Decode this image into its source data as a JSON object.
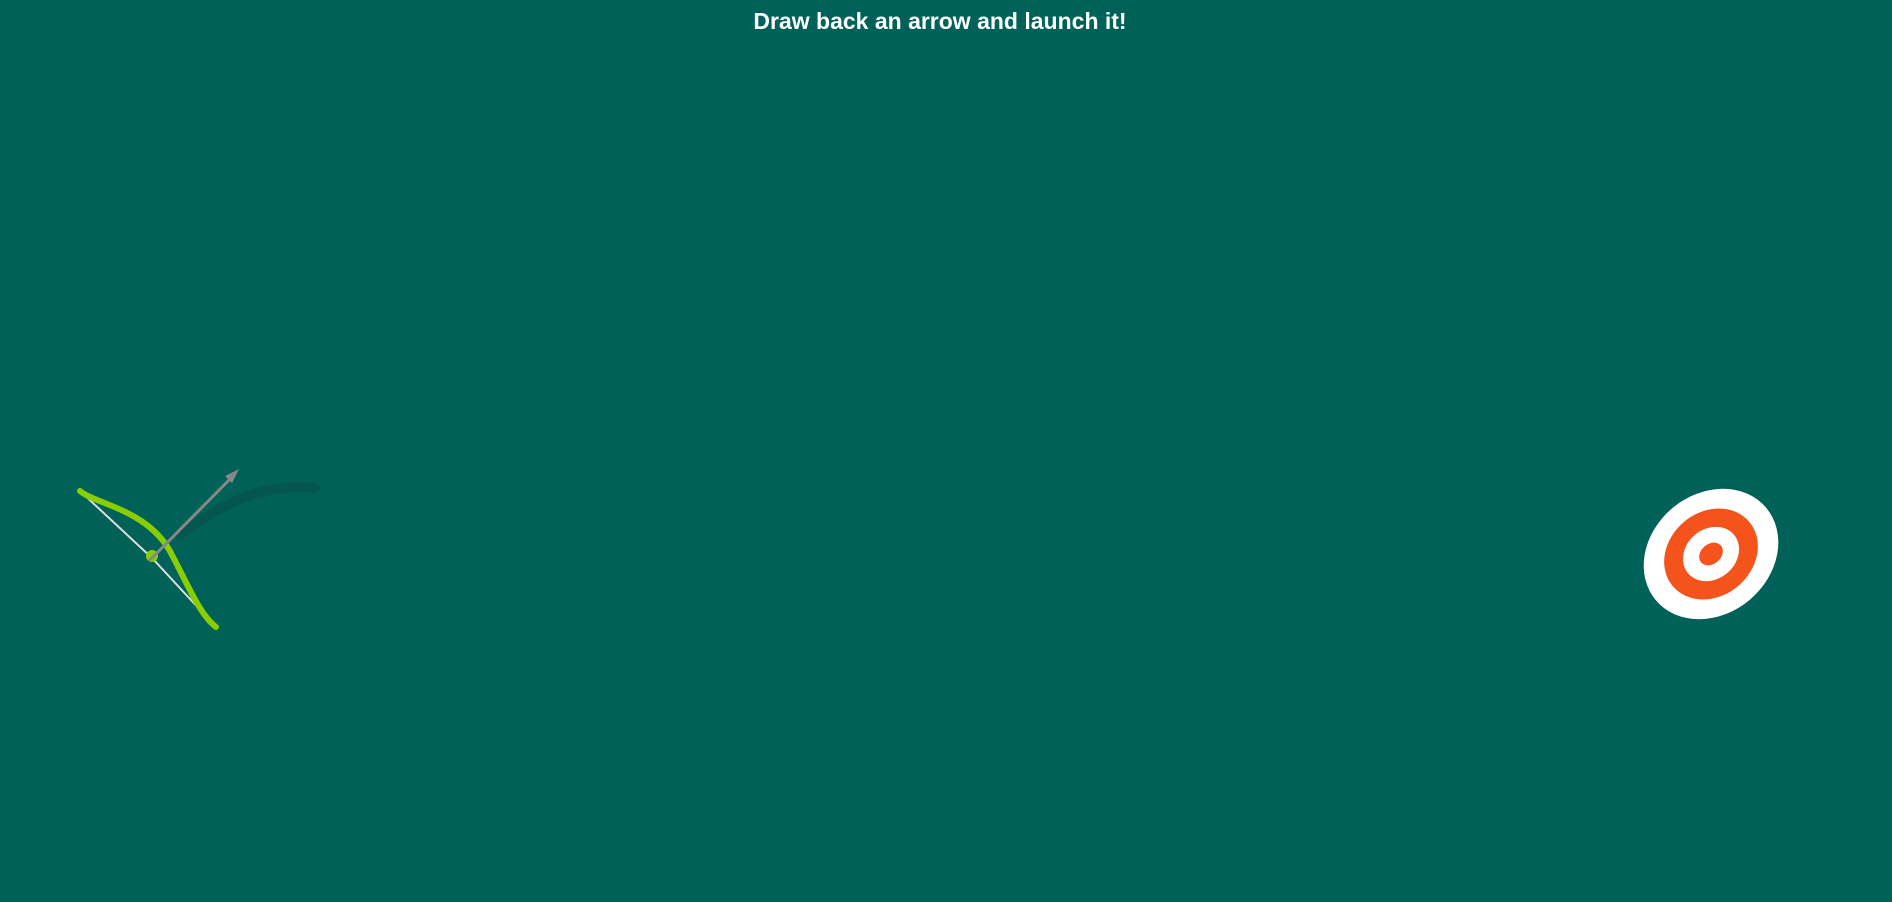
{
  "instructions": "Draw back an arrow and launch it!",
  "colors": {
    "background": "#006159",
    "bow": "#88ce02",
    "bowstring": "#dddddd",
    "arrow": "#888888",
    "arrow_trail": "#0a4f4a",
    "target_outer": "#ffffff",
    "target_ring": "#f4531c"
  },
  "icons": {
    "bow": "bow-icon",
    "arrow": "arrow-icon",
    "target": "target-icon"
  }
}
